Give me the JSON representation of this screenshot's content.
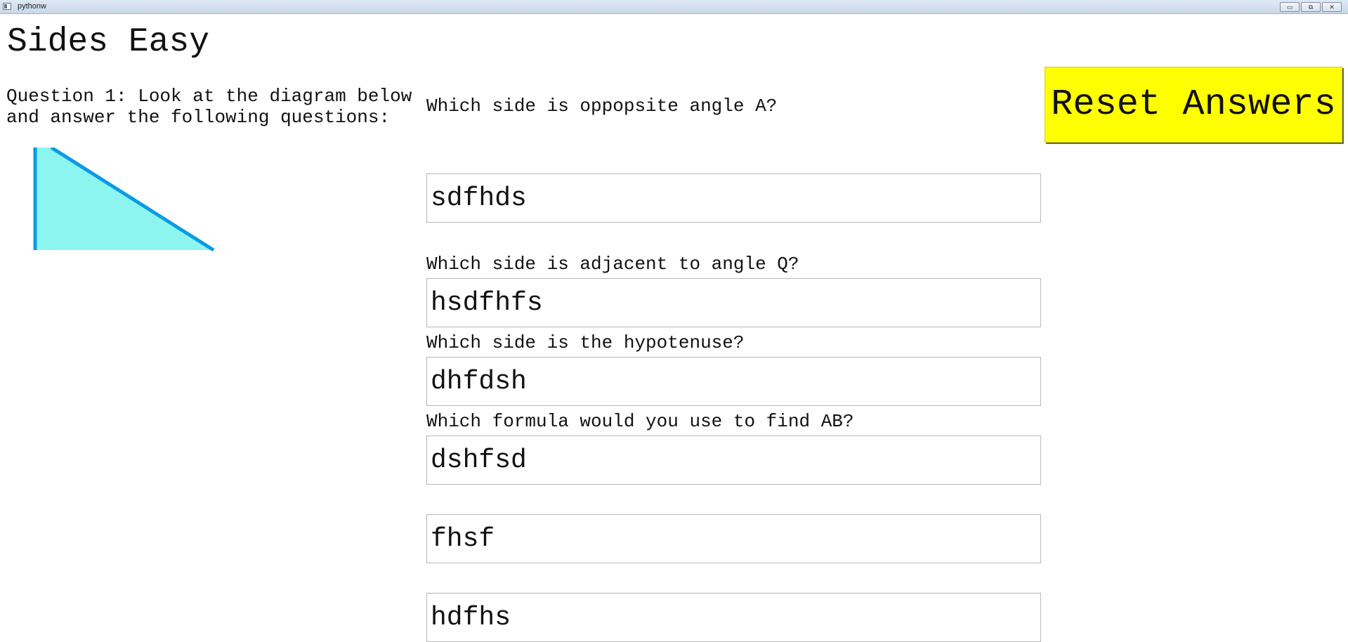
{
  "window": {
    "title": "pythonw",
    "controls": {
      "minimize": "▭",
      "restore": "⧉",
      "close": "✕"
    }
  },
  "header": {
    "title": "Sides Easy"
  },
  "question": {
    "prompt_line1": "Question 1: Look at the diagram below",
    "prompt_line2": "and answer the following questions:"
  },
  "diagram": {
    "fill_color": "#8cf5ef",
    "stroke_color": "#0a9be6"
  },
  "fields": {
    "labels": [
      "Which side is oppopsite angle A?",
      "Which side is adjacent to angle Q?",
      "Which side is the hypotenuse?",
      "Which formula would you use to find AB?"
    ],
    "values": [
      "sdfhds",
      "hsdfhfs",
      "dhfdsh",
      "dshfsd",
      "fhsf",
      "hdfhs"
    ]
  },
  "reset_button": {
    "label": "Reset Answers",
    "color": "#ffff00"
  }
}
